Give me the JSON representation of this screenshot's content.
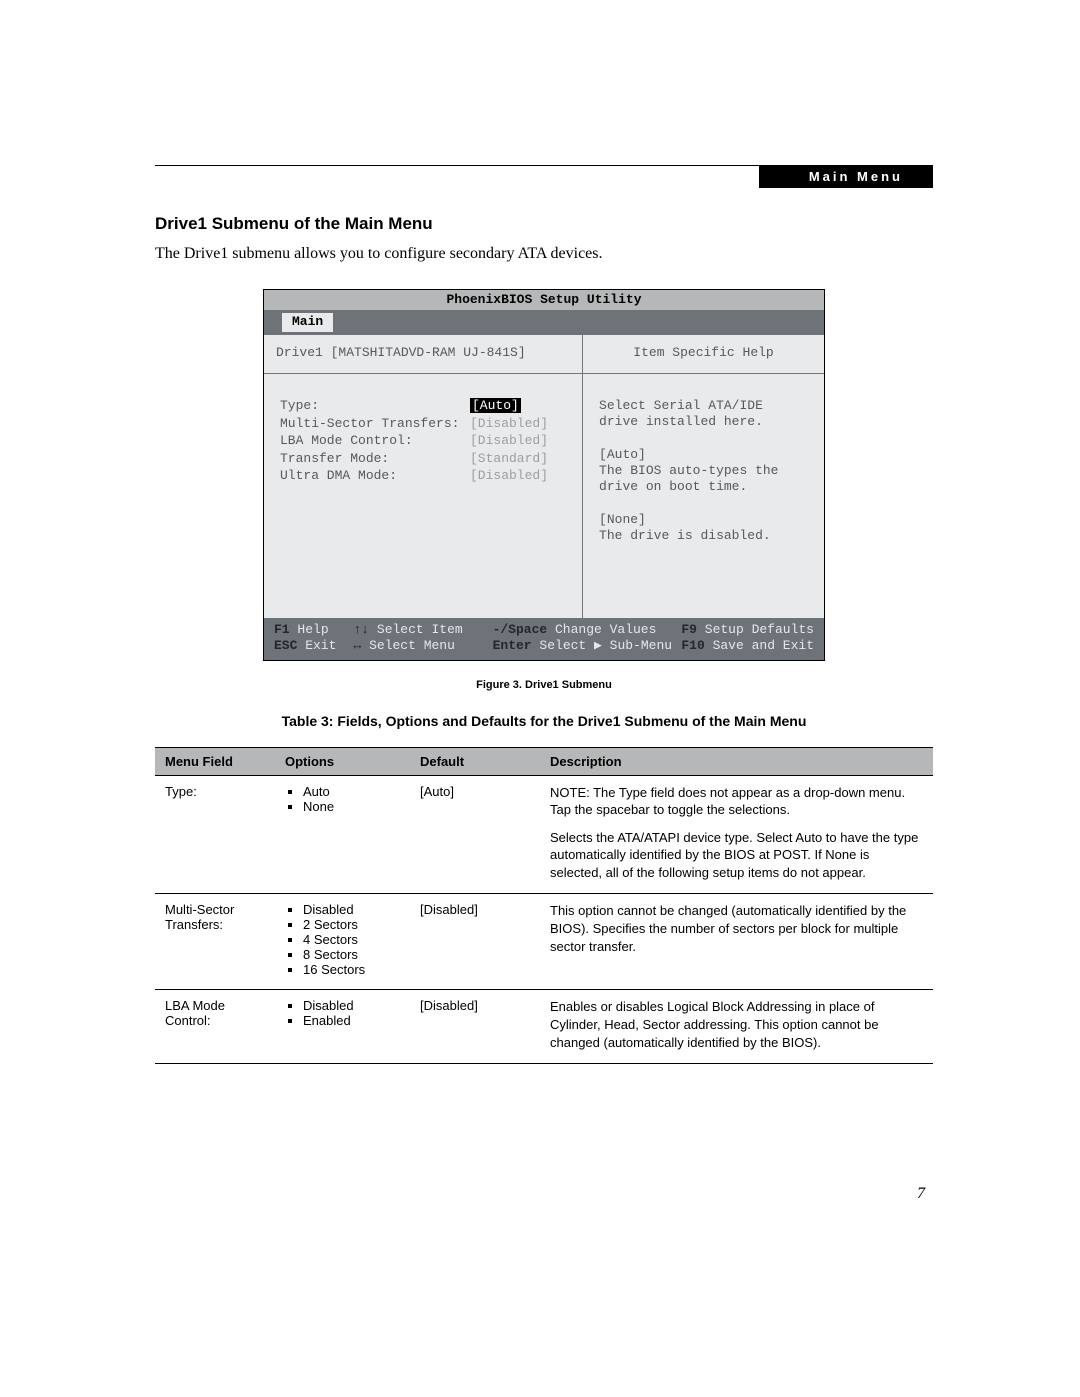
{
  "header": {
    "tab": "Main Menu"
  },
  "section": {
    "title": "Drive1 Submenu of the Main Menu",
    "intro": "The Drive1 submenu allows you to configure secondary ATA devices."
  },
  "bios": {
    "utility_title": "PhoenixBIOS Setup Utility",
    "menu_tab": "Main",
    "left_header": "Drive1 [MATSHITADVD-RAM UJ-841S]",
    "right_header": "Item Specific Help",
    "fields": [
      {
        "label": "Type:",
        "value": "[Auto]",
        "highlighted": true
      },
      {
        "label": "",
        "value": ""
      },
      {
        "label": "Multi-Sector Transfers:",
        "value": "[Disabled]"
      },
      {
        "label": "LBA Mode Control:",
        "value": "[Disabled]"
      },
      {
        "label": "Transfer Mode:",
        "value": "[Standard]"
      },
      {
        "label": "Ultra DMA Mode:",
        "value": "[Disabled]"
      }
    ],
    "help_lines": [
      "Select Serial ATA/IDE",
      "drive installed here.",
      "",
      "[Auto]",
      "The BIOS auto-types the",
      "drive on boot time.",
      "",
      "[None]",
      "The drive is disabled."
    ],
    "footer": {
      "row1": [
        {
          "key": "F1",
          "label": "Help"
        },
        {
          "key": "↑↓",
          "label": "Select Item"
        },
        {
          "key": "-/Space",
          "label": "Change Values"
        },
        {
          "key": "F9",
          "label": "Setup Defaults"
        }
      ],
      "row2": [
        {
          "key": "ESC",
          "label": "Exit"
        },
        {
          "key": "↔",
          "label": "Select Menu"
        },
        {
          "key": "Enter",
          "label": "Select ▶ Sub-Menu"
        },
        {
          "key": "F10",
          "label": "Save and Exit"
        }
      ]
    }
  },
  "figure_caption": "Figure 3.  Drive1 Submenu",
  "table_caption": "Table 3: Fields, Options and Defaults for the Drive1 Submenu of the Main Menu",
  "table": {
    "headers": [
      "Menu Field",
      "Options",
      "Default",
      "Description"
    ],
    "rows": [
      {
        "menu_field": "Type:",
        "options": [
          "Auto",
          "None"
        ],
        "default": "[Auto]",
        "description": [
          "NOTE: The Type field does not appear as a drop-down menu. Tap the spacebar to toggle the selections.",
          "Selects the ATA/ATAPI device type. Select Auto to have the type automatically identified by the BIOS at POST. If None is selected, all of the following setup items do not appear."
        ]
      },
      {
        "menu_field": "Multi-Sector Transfers:",
        "options": [
          "Disabled",
          "2 Sectors",
          "4 Sectors",
          "8 Sectors",
          "16 Sectors"
        ],
        "default": "[Disabled]",
        "description": [
          "This option cannot be changed (automatically identified by the BIOS). Specifies the number of sectors per block for multiple sector transfer."
        ]
      },
      {
        "menu_field": "LBA Mode Control:",
        "options": [
          "Disabled",
          "Enabled"
        ],
        "default": "[Disabled]",
        "description": [
          "Enables or disables Logical Block Addressing in place of Cylinder, Head, Sector addressing. This option cannot be changed (automatically identified by the BIOS)."
        ]
      }
    ]
  },
  "page_number": "7"
}
